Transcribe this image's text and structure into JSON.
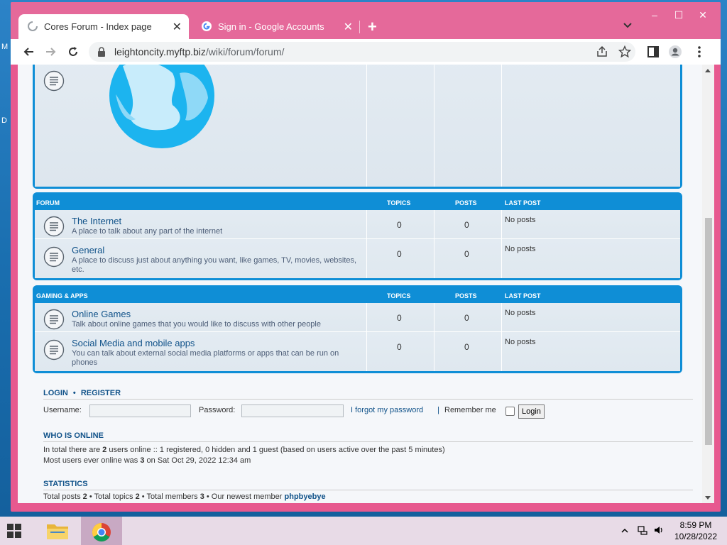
{
  "desktop": {
    "left_letters": [
      "M",
      "D"
    ]
  },
  "browser": {
    "tabs": [
      {
        "title": "Cores Forum - Index page",
        "active": true
      },
      {
        "title": "Sign in - Google Accounts",
        "active": false
      }
    ],
    "url": {
      "host": "leightoncity.myftp.biz",
      "path": "/wiki/forum/forum/"
    }
  },
  "forum_sections": [
    {
      "header": "FORUM",
      "cols": {
        "topics": "TOPICS",
        "posts": "POSTS",
        "lastpost": "LAST POST"
      },
      "rows": [
        {
          "title": "The Internet",
          "desc": "A place to talk about any part of the internet",
          "topics": "0",
          "posts": "0",
          "lastpost": "No posts"
        },
        {
          "title": "General",
          "desc": "A place to discuss just about anything you want, like games, TV, movies, websites, etc.",
          "topics": "0",
          "posts": "0",
          "lastpost": "No posts"
        }
      ]
    },
    {
      "header": "GAMING & APPS",
      "cols": {
        "topics": "TOPICS",
        "posts": "POSTS",
        "lastpost": "LAST POST"
      },
      "rows": [
        {
          "title": "Online Games",
          "desc": "Talk about online games that you would like to discuss with other people",
          "topics": "0",
          "posts": "0",
          "lastpost": "No posts"
        },
        {
          "title": "Social Media and mobile apps",
          "desc": "You can talk about external social media platforms or apps that can be run on phones",
          "topics": "0",
          "posts": "0",
          "lastpost": "No posts"
        }
      ]
    }
  ],
  "login": {
    "login_label": "LOGIN",
    "register_label": "REGISTER",
    "username_label": "Username:",
    "password_label": "Password:",
    "forgot_label": "I forgot my password",
    "remember_label": "Remember me",
    "button_label": "Login"
  },
  "who_is_online": {
    "title": "WHO IS ONLINE",
    "line1_pre": "In total there are ",
    "line1_count": "2",
    "line1_post": " users online :: 1 registered, 0 hidden and 1 guest (based on users active over the past 5 minutes)",
    "line2_pre": "Most users ever online was ",
    "line2_count": "3",
    "line2_post": " on Sat Oct 29, 2022 12:34 am"
  },
  "statistics": {
    "title": "STATISTICS",
    "posts_label": "Total posts ",
    "posts": "2",
    "topics_label": " • Total topics ",
    "topics": "2",
    "members_label": " • Total members ",
    "members": "3",
    "newest_label": " • Our newest member ",
    "newest": "phpbyebye"
  },
  "taskbar": {
    "time": "8:59 PM",
    "date": "10/28/2022"
  }
}
